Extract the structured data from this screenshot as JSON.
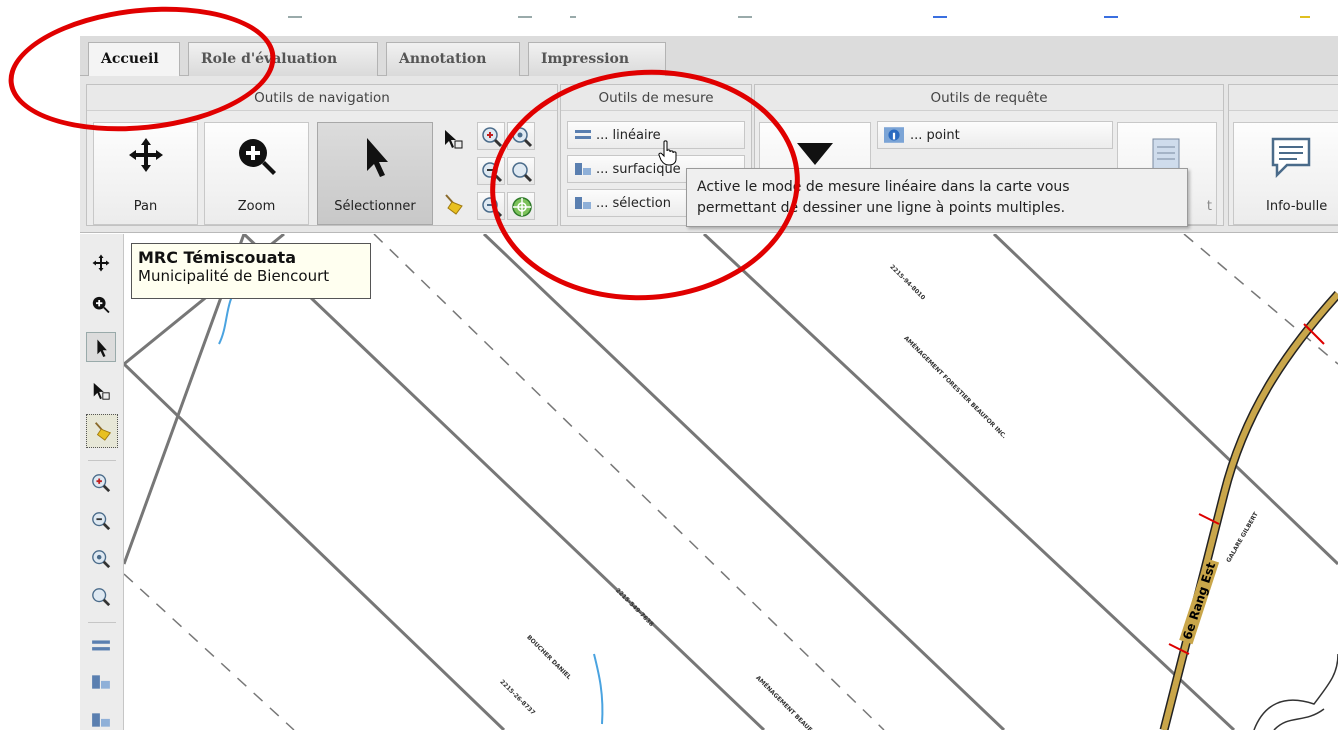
{
  "tabs": [
    {
      "label": "Accueil"
    },
    {
      "label": "Role d'évaluation"
    },
    {
      "label": "Annotation"
    },
    {
      "label": "Impression"
    }
  ],
  "groups": {
    "navigation": {
      "title": "Outils de navigation",
      "pan_label": "Pan",
      "zoom_label": "Zoom",
      "select_label": "Sélectionner"
    },
    "mesure": {
      "title": "Outils de mesure",
      "items": [
        "... linéaire",
        "... surfacique",
        "... sélection"
      ]
    },
    "requete": {
      "title": "Outils de requête",
      "point_label": "... point",
      "last_label": "t"
    },
    "info": {
      "label": "Info-bulle"
    }
  },
  "tooltip": {
    "line1": "Active le mode de mesure linéaire dans la carte vous",
    "line2": "permettant de dessiner une ligne à points multiples."
  },
  "map_info": {
    "title": "MRC Témiscouata",
    "subtitle": "Municipalité de Biencourt"
  },
  "map": {
    "road_label": "6e Rang Est",
    "labels": [
      "AMÉNAGEMENT FORESTIER BEAUFOR INC.",
      "BOUCHER DANIEL",
      "GALARE GILBERT",
      "2215-549-7638",
      "2215-94-8010",
      "2215-26-8737",
      "AMÉNAGEMENT BEAUFOR"
    ]
  },
  "colors": {
    "annotation": "#e00000",
    "road": "#c9a64a",
    "river": "#4aa3e0"
  }
}
